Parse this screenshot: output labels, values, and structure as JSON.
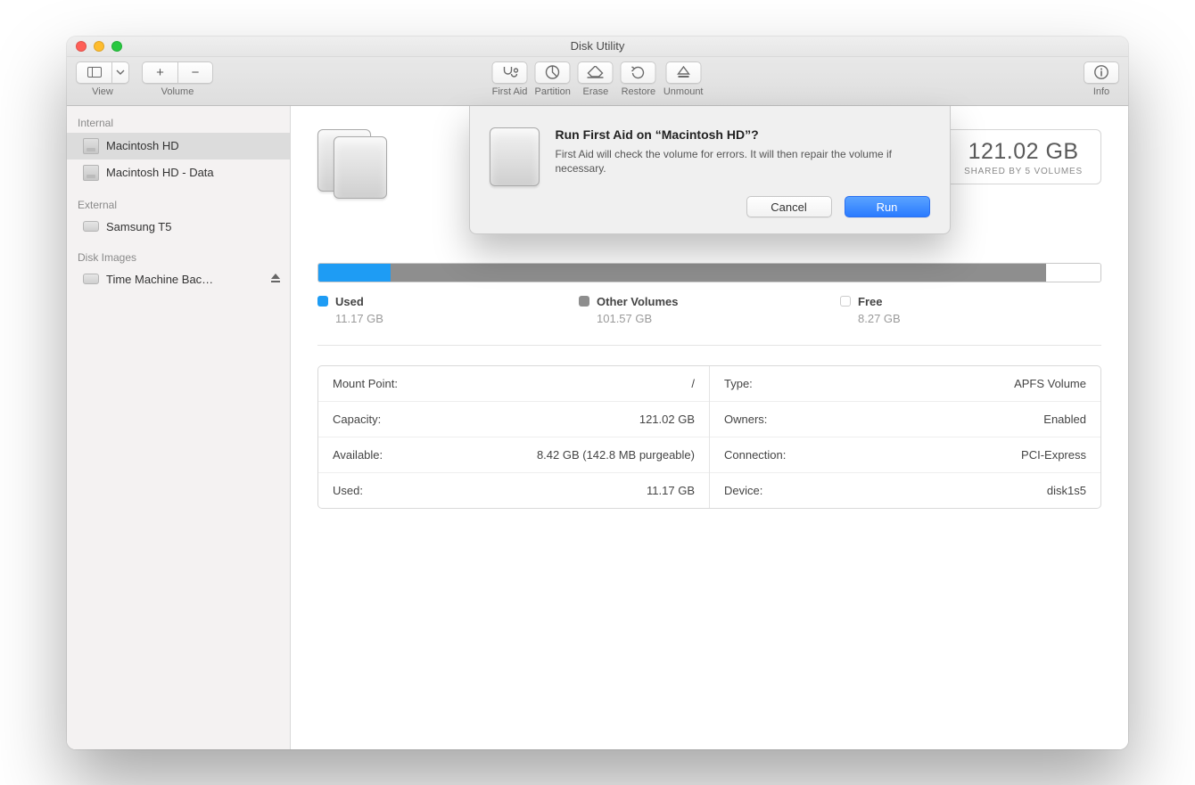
{
  "window": {
    "title": "Disk Utility"
  },
  "toolbar": {
    "view_label": "View",
    "volume_label": "Volume",
    "first_aid_label": "First Aid",
    "partition_label": "Partition",
    "erase_label": "Erase",
    "restore_label": "Restore",
    "unmount_label": "Unmount",
    "info_label": "Info"
  },
  "sidebar": {
    "sections": {
      "internal": {
        "title": "Internal",
        "items": [
          "Macintosh HD",
          "Macintosh HD - Data"
        ]
      },
      "external": {
        "title": "External",
        "items": [
          "Samsung T5"
        ]
      },
      "images": {
        "title": "Disk Images",
        "items": [
          "Time Machine Bac…"
        ]
      }
    }
  },
  "main": {
    "capacity_box": {
      "size": "121.02 GB",
      "subtitle": "SHARED BY 5 VOLUMES"
    },
    "usage": {
      "used": {
        "label": "Used",
        "value": "11.17 GB",
        "pct": 9.2
      },
      "other": {
        "label": "Other Volumes",
        "value": "101.57 GB",
        "pct": 83.9
      },
      "free": {
        "label": "Free",
        "value": "8.27 GB",
        "pct": 6.9
      }
    },
    "details": {
      "left": [
        {
          "k": "Mount Point:",
          "v": "/"
        },
        {
          "k": "Capacity:",
          "v": "121.02 GB"
        },
        {
          "k": "Available:",
          "v": "8.42 GB (142.8 MB purgeable)"
        },
        {
          "k": "Used:",
          "v": "11.17 GB"
        }
      ],
      "right": [
        {
          "k": "Type:",
          "v": "APFS Volume"
        },
        {
          "k": "Owners:",
          "v": "Enabled"
        },
        {
          "k": "Connection:",
          "v": "PCI-Express"
        },
        {
          "k": "Device:",
          "v": "disk1s5"
        }
      ]
    }
  },
  "dialog": {
    "title": "Run First Aid on “Macintosh HD”?",
    "body": "First Aid will check the volume for errors. It will then repair the volume if necessary.",
    "cancel_label": "Cancel",
    "run_label": "Run"
  }
}
